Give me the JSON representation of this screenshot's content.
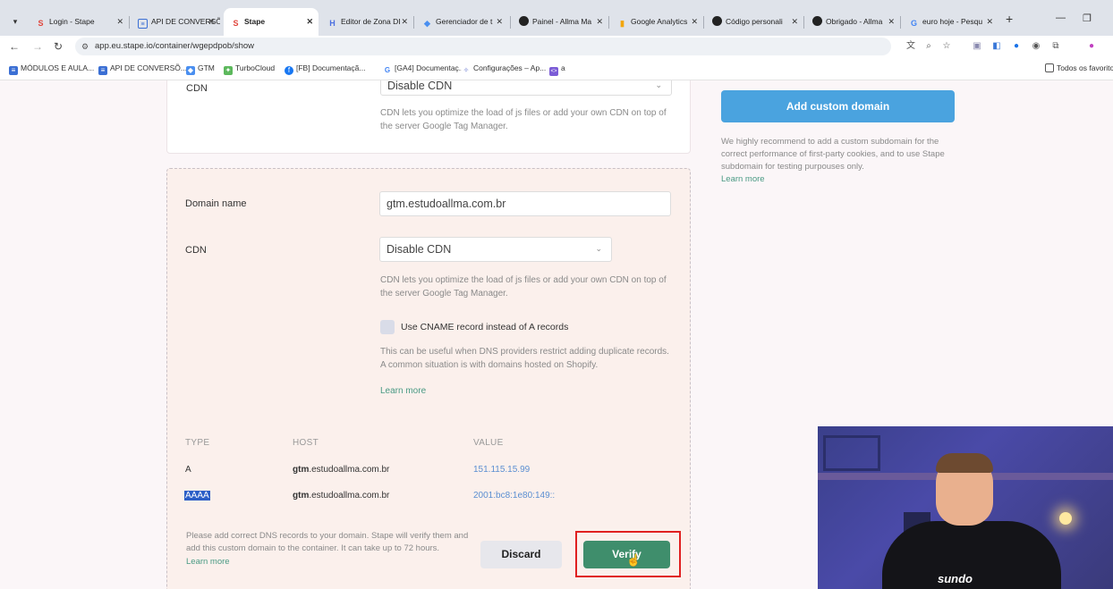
{
  "browser": {
    "tabs": [
      {
        "title": "Login - Stape",
        "icon": "stape-icon"
      },
      {
        "title": "API DE CONVERSÕ",
        "icon": "doc-icon"
      },
      {
        "title": "Stape",
        "icon": "stape-icon",
        "active": true
      },
      {
        "title": "Editor de Zona DI",
        "icon": "dns-icon"
      },
      {
        "title": "Gerenciador de t",
        "icon": "tag-icon"
      },
      {
        "title": "Painel - Allma Ma",
        "icon": "wp-icon"
      },
      {
        "title": "Google Analytics",
        "icon": "analytics-icon"
      },
      {
        "title": "Código personali",
        "icon": "wp-icon"
      },
      {
        "title": "Obrigado - Allma",
        "icon": "wp-icon"
      },
      {
        "title": "euro hoje - Pesqu",
        "icon": "google-icon"
      }
    ],
    "url": "app.eu.stape.io/container/wgepdpob/show",
    "bookmarks": [
      "MÓDULOS E AULA...",
      "API DE CONVERSÕ...",
      "GTM",
      "TurboCloud",
      "[FB] Documentaçã...",
      "[GA4] Documentaç...",
      "Configurações – Ap...",
      "a"
    ],
    "bookmarks_folder": "Todos os favoritos"
  },
  "top_card": {
    "cdn_label": "CDN",
    "cdn_value": "Disable CDN",
    "cdn_help": "CDN lets you optimize the load of js files or add your own CDN on top of the server Google Tag Manager."
  },
  "domain_card": {
    "domain_label": "Domain name",
    "domain_value": "gtm.estudoallma.com.br",
    "cdn_label": "CDN",
    "cdn_value": "Disable CDN",
    "cdn_help": "CDN lets you optimize the load of js files or add your own CDN on top of the server Google Tag Manager.",
    "cname_label": "Use CNAME record instead of A records",
    "cname_help": "This can be useful when DNS providers restrict adding duplicate records. A common situation is with domains hosted on Shopify.",
    "learn_more": "Learn more",
    "table": {
      "headers": [
        "TYPE",
        "HOST",
        "VALUE"
      ],
      "rows": [
        {
          "type": "A",
          "host_bold": "gtm",
          "host_rest": ".estudoallma.com.br",
          "value": "151.115.15.99"
        },
        {
          "type": "AAAA",
          "host_bold": "gtm",
          "host_rest": ".estudoallma.com.br",
          "value": "2001:bc8:1e80:149::"
        }
      ]
    },
    "footer_help": "Please add correct DNS records to your domain. Stape will verify them and add this custom domain to the container. It can take up to 72 hours.",
    "footer_learn_more": "Learn more",
    "discard_label": "Discard",
    "verify_label": "Verify"
  },
  "sidebar": {
    "add_domain_label": "Add custom domain",
    "help": "We highly recommend to add a custom subdomain for the correct performance of first-party cookies, and to use Stape subdomain for testing purpouses only.",
    "learn_more": "Learn more"
  },
  "webcam": {
    "shirt_text": "sundo"
  },
  "colors": {
    "verify_green": "#3f8e6c",
    "add_domain_blue": "#4aa3df",
    "highlight_red": "#e02020",
    "link_green": "#4a9a84"
  }
}
